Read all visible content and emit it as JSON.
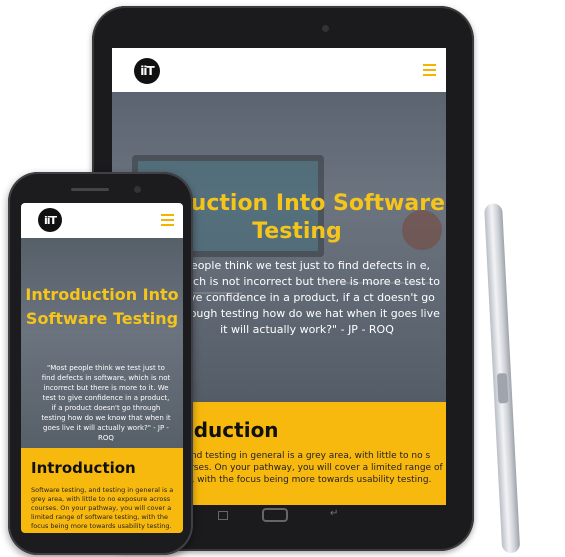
{
  "tablet": {
    "logo": "iiT",
    "hero_title": "Introduction Into Software Testing",
    "hero_title_visible": "roduction Into Software Testing",
    "quote_visible": "people think we test just to find defects in e, which is not incorrect but there is more e test to give confidence in a product, if a ct doesn't go through testing how do we hat when it goes live it will actually work?\" - JP - ROQ",
    "intro_heading": "oduction",
    "intro_text": "g, and testing in general is a grey area, with little to no s courses. On your pathway, you will cover a limited range of ting, with the focus being more towards usability testing."
  },
  "phone": {
    "logo": "iiT",
    "hero_title": "Introduction Into Software Testing",
    "quote": "\"Most people think we test just to find defects in software, which is not incorrect but there is more to it. We test to give confidence in a product, if a product doesn't go through testing how do we know that when it goes live it will actually work?\" - JP - ROQ",
    "intro_heading": "Introduction",
    "intro_text": "Software testing, and testing in general is a grey area, with little to no exposure across courses. On your pathway, you will cover a limited range of software testing, with the focus being more towards usability testing."
  },
  "colors": {
    "accent": "#f8b90e",
    "title": "#f5c51c",
    "device": "#1c1c1f"
  },
  "icons": [
    "hamburger-menu-icon",
    "back-icon",
    "home-button",
    "recent-apps-icon"
  ]
}
